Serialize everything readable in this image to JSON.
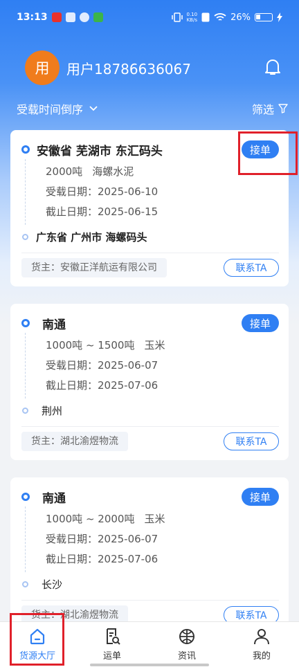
{
  "status": {
    "time": "13:13",
    "speed_top": "0.10",
    "speed_bottom": "KB/s",
    "battery": "26%"
  },
  "header": {
    "avatar_char": "用",
    "user_name": "用户18786636067"
  },
  "toolbar": {
    "sort_label": "受载时间倒序",
    "filter_label": "筛选"
  },
  "orders": [
    {
      "origin": "安徽省 芜湖市 东汇码头",
      "cargo_qty": "2000吨",
      "cargo_type": "海螺水泥",
      "load_date": "受载日期：2025-06-10",
      "end_date": "截止日期：2025-06-15",
      "destination": "广东省 广州市 海螺码头",
      "owner": "货主：安徽正洋航运有限公司",
      "accept_label": "接单",
      "contact_label": "联系TA"
    },
    {
      "origin": "南通",
      "cargo_qty": "1000吨 ~ 1500吨",
      "cargo_type": "玉米",
      "load_date": "受载日期：2025-06-07",
      "end_date": "截止日期：2025-07-06",
      "destination": "荆州",
      "owner": "货主：湖北渝煜物流",
      "accept_label": "接单",
      "contact_label": "联系TA"
    },
    {
      "origin": "南通",
      "cargo_qty": "1000吨 ~ 2000吨",
      "cargo_type": "玉米",
      "load_date": "受载日期：2025-06-07",
      "end_date": "截止日期：2025-07-06",
      "destination": "长沙",
      "owner": "货主：湖北渝煜物流",
      "accept_label": "接单",
      "contact_label": "联系TA"
    }
  ],
  "tabs": [
    {
      "label": "货源大厅",
      "icon": "home-icon",
      "active": true
    },
    {
      "label": "运单",
      "icon": "waybill-icon",
      "active": false
    },
    {
      "label": "资讯",
      "icon": "news-icon",
      "active": false
    },
    {
      "label": "我的",
      "icon": "user-icon",
      "active": false
    }
  ],
  "colors": {
    "primary": "#2f7ff3",
    "avatar": "#f07c1c",
    "highlight": "#e0202a"
  }
}
